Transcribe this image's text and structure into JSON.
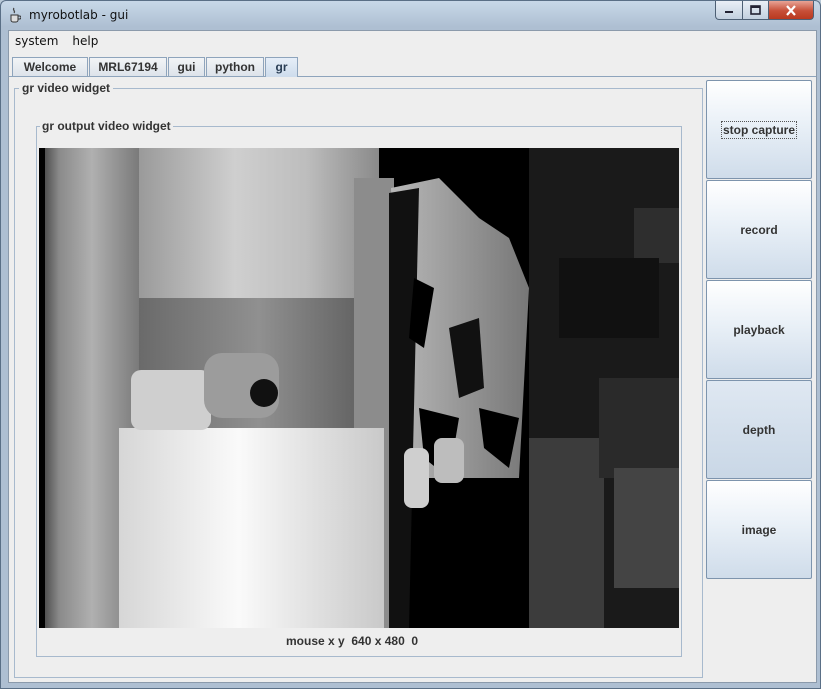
{
  "window": {
    "title": "myrobotlab - gui"
  },
  "menu": {
    "items": [
      "system",
      "help"
    ]
  },
  "tabs": [
    {
      "label": "Welcome"
    },
    {
      "label": "MRL67194"
    },
    {
      "label": "gui"
    },
    {
      "label": "python"
    },
    {
      "label": "gr",
      "active": true
    }
  ],
  "video_widget": {
    "title": "gr  video widget",
    "output_title": "gr output video widget",
    "status": "mouse x y  640 x 480  0"
  },
  "buttons": [
    {
      "label": "stop capture",
      "focused": true
    },
    {
      "label": "record"
    },
    {
      "label": "playback"
    },
    {
      "label": "depth",
      "pressed": true
    },
    {
      "label": "image"
    }
  ],
  "colors": {
    "accent": "#8ea4bc",
    "close": "#c74f38"
  }
}
